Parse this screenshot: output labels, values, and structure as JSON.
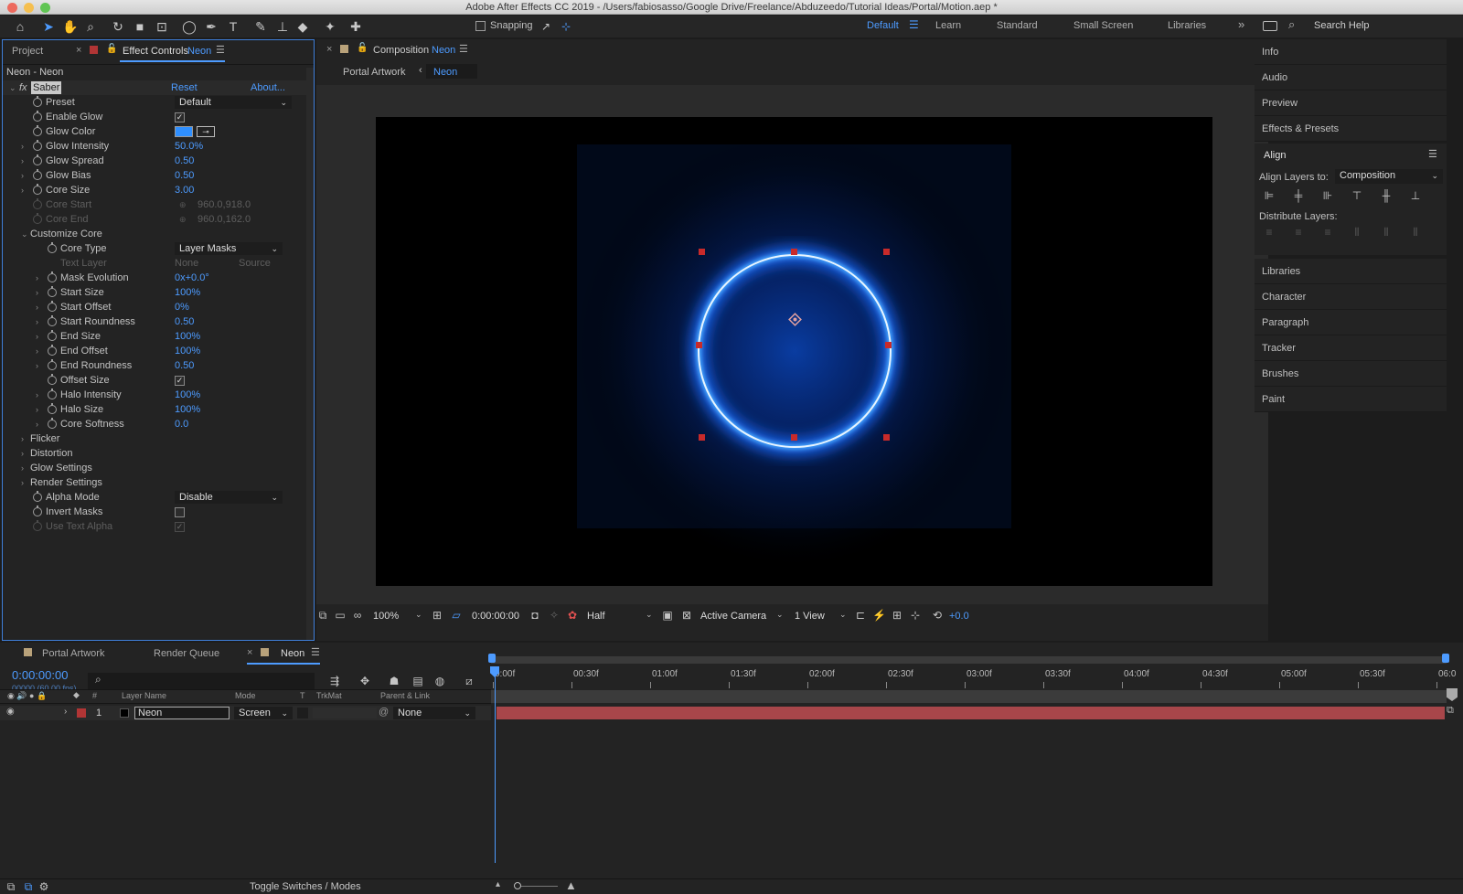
{
  "window": {
    "title": "Adobe After Effects CC 2019 - /Users/fabiosasso/Google Drive/Freelance/Abduzeedo/Tutorial Ideas/Portal/Motion.aep *"
  },
  "toolbar": {
    "snapping_label": "Snapping",
    "workspaces": [
      "Default",
      "Learn",
      "Standard",
      "Small Screen",
      "Libraries"
    ],
    "search_placeholder": "Search Help"
  },
  "left_panel": {
    "tab_project": "Project",
    "tab_effect_controls": "Effect Controls",
    "tab_effect_controls_layer": "Neon",
    "layer_path": "Neon - Neon",
    "effect": {
      "name": "Saber",
      "reset": "Reset",
      "about": "About..."
    },
    "rows": [
      {
        "label": "Preset",
        "value": "Default",
        "kind": "dropdown"
      },
      {
        "label": "Enable Glow",
        "value": "checked",
        "kind": "check"
      },
      {
        "label": "Glow Color",
        "value": "",
        "kind": "color"
      },
      {
        "label": "Glow Intensity",
        "value": "50.0%"
      },
      {
        "label": "Glow Spread",
        "value": "0.50"
      },
      {
        "label": "Glow Bias",
        "value": "0.50"
      },
      {
        "label": "Core Size",
        "value": "3.00"
      },
      {
        "label": "Core Start",
        "value": "960.0,918.0",
        "disabled": true
      },
      {
        "label": "Core End",
        "value": "960.0,162.0",
        "disabled": true
      },
      {
        "label": "Customize Core",
        "value": "",
        "group": true
      },
      {
        "label": "Core Type",
        "value": "Layer Masks",
        "kind": "dropdown"
      },
      {
        "label": "Text Layer",
        "value": "None",
        "value2": "Source",
        "disabled": true
      },
      {
        "label": "Mask Evolution",
        "value": "0x+0.0°"
      },
      {
        "label": "Start Size",
        "value": "100%"
      },
      {
        "label": "Start Offset",
        "value": "0%"
      },
      {
        "label": "Start Roundness",
        "value": "0.50"
      },
      {
        "label": "End Size",
        "value": "100%"
      },
      {
        "label": "End Offset",
        "value": "100%"
      },
      {
        "label": "End Roundness",
        "value": "0.50"
      },
      {
        "label": "Offset Size",
        "value": "checked",
        "kind": "check"
      },
      {
        "label": "Halo Intensity",
        "value": "100%"
      },
      {
        "label": "Halo Size",
        "value": "100%"
      },
      {
        "label": "Core Softness",
        "value": "0.0"
      },
      {
        "label": "Flicker",
        "group": true
      },
      {
        "label": "Distortion",
        "group": true
      },
      {
        "label": "Glow Settings",
        "group": true
      },
      {
        "label": "Render Settings",
        "group": true
      },
      {
        "label": "Alpha Mode",
        "value": "Disable",
        "kind": "dropdown"
      },
      {
        "label": "Invert Masks",
        "value": "unchecked",
        "kind": "check"
      },
      {
        "label": "Use Text Alpha",
        "value": "checked",
        "kind": "check",
        "disabled": true
      }
    ]
  },
  "composition": {
    "tab_label": "Composition",
    "tab_name": "Neon",
    "breadcrumb_parent": "Portal Artwork",
    "breadcrumb_current": "Neon",
    "zoom": "100%",
    "timecode": "0:00:00:00",
    "resolution": "Half",
    "camera": "Active Camera",
    "views": "1 View",
    "exposure": "+0.0"
  },
  "right_panel": {
    "top_items": [
      "Info",
      "Audio",
      "Preview",
      "Effects & Presets"
    ],
    "align_title": "Align",
    "align_to_label": "Align Layers to:",
    "align_to_value": "Composition",
    "distribute_label": "Distribute Layers:",
    "bottom_items": [
      "Libraries",
      "Character",
      "Paragraph",
      "Tracker",
      "Brushes",
      "Paint"
    ]
  },
  "timeline": {
    "tabs": [
      "Portal Artwork",
      "Render Queue",
      "Neon"
    ],
    "timecode": "0:00:00:00",
    "frame_info": "00000 (60.00 fps)",
    "columns": {
      "hash": "#",
      "layer_name": "Layer Name",
      "mode": "Mode",
      "t": "T",
      "trkmat": "TrkMat",
      "parent": "Parent & Link"
    },
    "layer": {
      "index": "1",
      "name": "Neon",
      "mode": "Screen",
      "parent": "None"
    },
    "ruler": [
      "0:00f",
      "00:30f",
      "01:00f",
      "01:30f",
      "02:00f",
      "02:30f",
      "03:00f",
      "03:30f",
      "04:00f",
      "04:30f",
      "05:00f",
      "05:30f",
      "06:0"
    ],
    "footer_toggle": "Toggle Switches / Modes"
  },
  "colors": {
    "accent": "#4d9bff",
    "layer_bar": "#a8464a",
    "glow": "#2f8fff"
  }
}
